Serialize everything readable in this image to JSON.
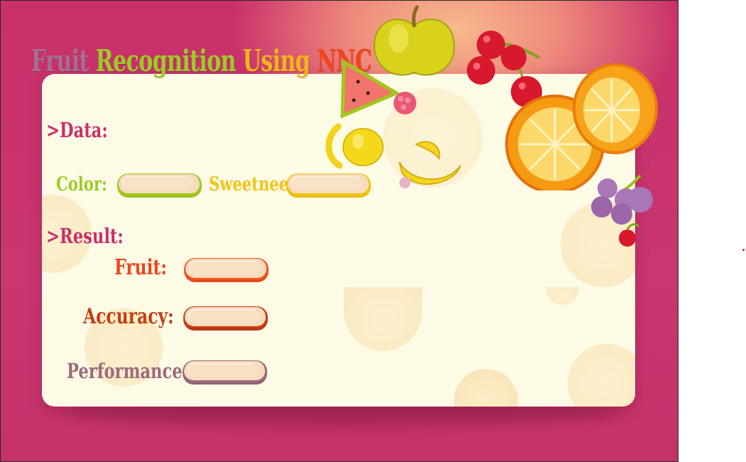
{
  "title": {
    "part1": "Fruit",
    "part2": "Recognition",
    "part3": "Using",
    "part4": "NNC"
  },
  "sections": {
    "data": ">Data:",
    "result": ">Result:"
  },
  "inputs": {
    "color": {
      "label": "Color:",
      "value": ""
    },
    "sweetness": {
      "label": "Sweetnees:",
      "value": ""
    }
  },
  "outputs": {
    "fruit": {
      "label": "Fruit:",
      "value": ""
    },
    "accuracy": {
      "label": "Accuracy:",
      "value": ""
    },
    "performance": {
      "label": "Performance:",
      "value": ""
    }
  },
  "colors": {
    "background": "#c9306a",
    "panel": "#fdfbe6",
    "green": "#9ccc26",
    "yellow": "#f2b619",
    "orange": "#f2431c",
    "rust": "#c43d14",
    "mauve": "#a56f8f"
  },
  "decorations": [
    "apple-icon",
    "watermelon-slice-icon",
    "raspberry-icon",
    "cherries-icon",
    "lemon-icon",
    "orange-halves-icon",
    "banana-icon",
    "grapes-icon"
  ]
}
